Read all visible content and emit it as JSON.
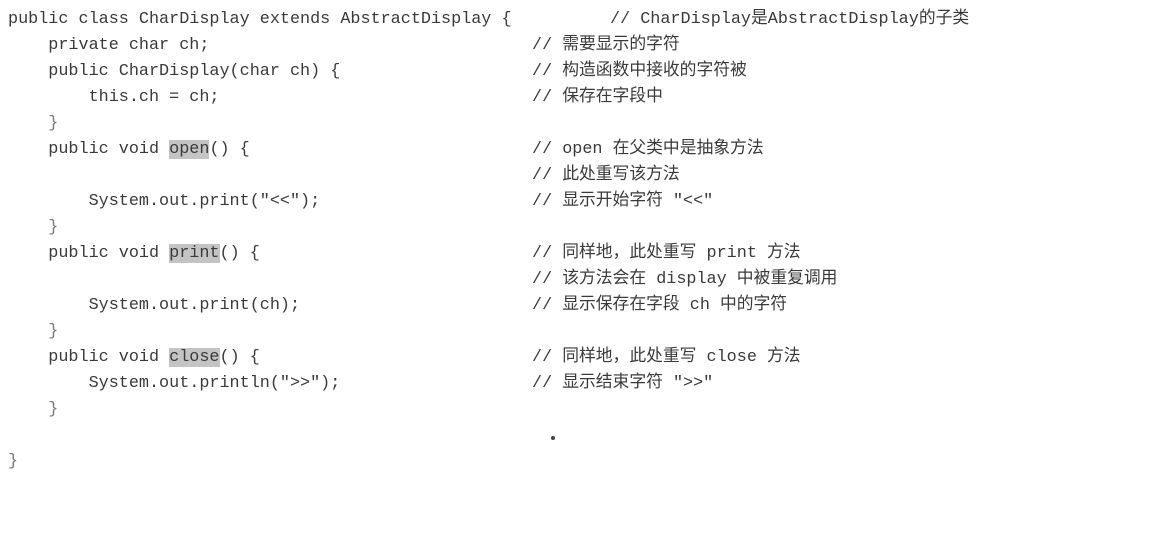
{
  "code": {
    "l1": "public class CharDisplay extends AbstractDisplay {  ",
    "l1_comment": "// CharDisplay是AbstractDisplay的子类",
    "l2": "    private char ch;",
    "l2_comment": "// 需要显示的字符",
    "l3": "    public CharDisplay(char ch) {",
    "l3_comment": "// 构造函数中接收的字符被",
    "l4": "        this.ch = ch;",
    "l4_comment": "// 保存在字段中",
    "l5": "    }",
    "l6_pre": "    public void ",
    "l6_hl": "open",
    "l6_post": "() {",
    "l6_comment": "// open 在父类中是抽象方法",
    "l7_comment": "// 此处重写该方法",
    "l8": "        System.out.print(\"<<\");",
    "l8_comment": "// 显示开始字符 \"<<\"",
    "l9": "    }",
    "l10_pre": "    public void ",
    "l10_hl": "print",
    "l10_post": "() {",
    "l10_comment": "// 同样地，此处重写 print 方法",
    "l11_comment": "// 该方法会在 display 中被重复调用",
    "l12": "        System.out.print(ch);",
    "l12_comment": "// 显示保存在字段 ch 中的字符",
    "l13": "    }",
    "l14_pre": "    public void ",
    "l14_hl": "close",
    "l14_post": "() {",
    "l14_comment": "// 同样地，此处重写 close 方法",
    "l15": "        System.out.println(\">>\");",
    "l15_comment": "// 显示结束字符 \">>\"",
    "l16": "    }",
    "l17": "}"
  }
}
